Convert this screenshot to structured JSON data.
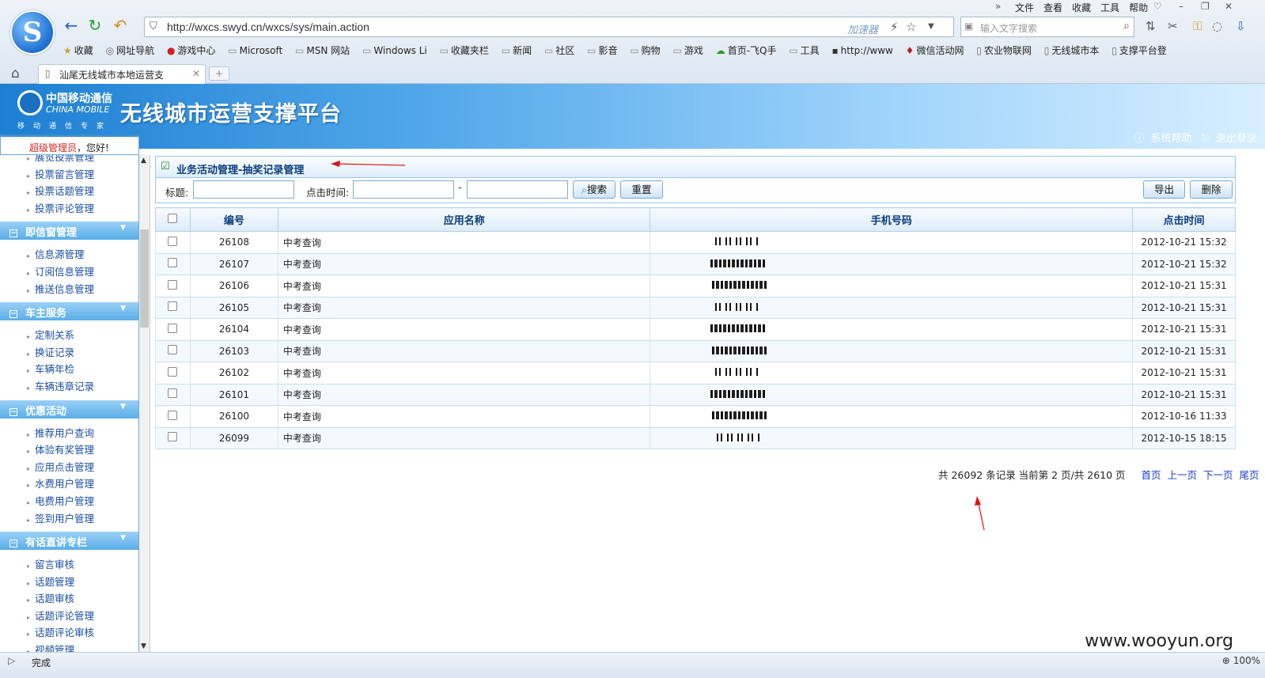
{
  "browser": {
    "url": "http://wxcs.swyd.cn/wxcs/sys/main.action",
    "accelerator": "加速器",
    "search_placeholder": "输入文字搜索",
    "menu": [
      "文件",
      "查看",
      "收藏",
      "工具",
      "帮助"
    ],
    "bookmarks": [
      "收藏",
      "网址导航",
      "游戏中心",
      "Microsoft",
      "MSN 网站",
      "Windows Li",
      "收藏夹栏",
      "新闻",
      "社区",
      "影音",
      "购物",
      "游戏",
      "首页-飞Q手",
      "工具",
      "http://www",
      "微信活动网",
      "农业物联网",
      "无线城市本",
      "支撑平台登"
    ],
    "tab_title": "汕尾无线城市本地运营支"
  },
  "header": {
    "brand_cn": "中国移动通信",
    "brand_en": "CHINA MOBILE",
    "slogan": "移动通信专家",
    "title": "无线城市运营支撑平台",
    "help": "系统帮助",
    "logout": "退出登录"
  },
  "welcome": {
    "role": "超级管理员",
    "greeting": "，您好!"
  },
  "sidebar": {
    "top_items": [
      "展览投票管理",
      "投票留言管理",
      "投票话题管理",
      "投票评论管理"
    ],
    "sections": [
      {
        "title": "即信窗管理",
        "items": [
          "信息源管理",
          "订阅信息管理",
          "推送信息管理"
        ]
      },
      {
        "title": "车主服务",
        "items": [
          "定制关系",
          "换证记录",
          "车辆年检",
          "车辆违章记录"
        ]
      },
      {
        "title": "优惠活动",
        "items": [
          "推荐用户查询",
          "体验有奖管理",
          "应用点击管理",
          "水费用户管理",
          "电费用户管理",
          "签到用户管理"
        ]
      },
      {
        "title": "有话直讲专栏",
        "items": [
          "留言审核",
          "话题管理",
          "话题审核",
          "话题评论管理",
          "话题评论审核",
          "视频管理"
        ]
      }
    ]
  },
  "panel": {
    "title": "业务活动管理-抽奖记录管理",
    "filter": {
      "title_label": "标题:",
      "time_label": "点击时间:",
      "dash": "-",
      "search": "搜索",
      "reset": "重置",
      "export": "导出",
      "delete": "删除"
    },
    "columns": [
      "编号",
      "应用名称",
      "手机号码",
      "点击时间"
    ],
    "rows": [
      {
        "id": "26108",
        "app": "中考查询",
        "time": "2012-10-21 15:32"
      },
      {
        "id": "26107",
        "app": "中考查询",
        "time": "2012-10-21 15:32"
      },
      {
        "id": "26106",
        "app": "中考查询",
        "time": "2012-10-21 15:31"
      },
      {
        "id": "26105",
        "app": "中考查询",
        "time": "2012-10-21 15:31"
      },
      {
        "id": "26104",
        "app": "中考查询",
        "time": "2012-10-21 15:31"
      },
      {
        "id": "26103",
        "app": "中考查询",
        "time": "2012-10-21 15:31"
      },
      {
        "id": "26102",
        "app": "中考查询",
        "time": "2012-10-21 15:31"
      },
      {
        "id": "26101",
        "app": "中考查询",
        "time": "2012-10-21 15:31"
      },
      {
        "id": "26100",
        "app": "中考查询",
        "time": "2012-10-16 11:33"
      },
      {
        "id": "26099",
        "app": "中考查询",
        "time": "2012-10-15 18:15"
      }
    ],
    "pager": {
      "summary": "共 26092 条记录 当前第 2 页/共 2610 页",
      "first": "首页",
      "prev": "上一页",
      "next": "下一页",
      "last": "尾页"
    }
  },
  "status": {
    "text": "完成",
    "zoom": "100%"
  },
  "watermark": "www.wooyun.org"
}
